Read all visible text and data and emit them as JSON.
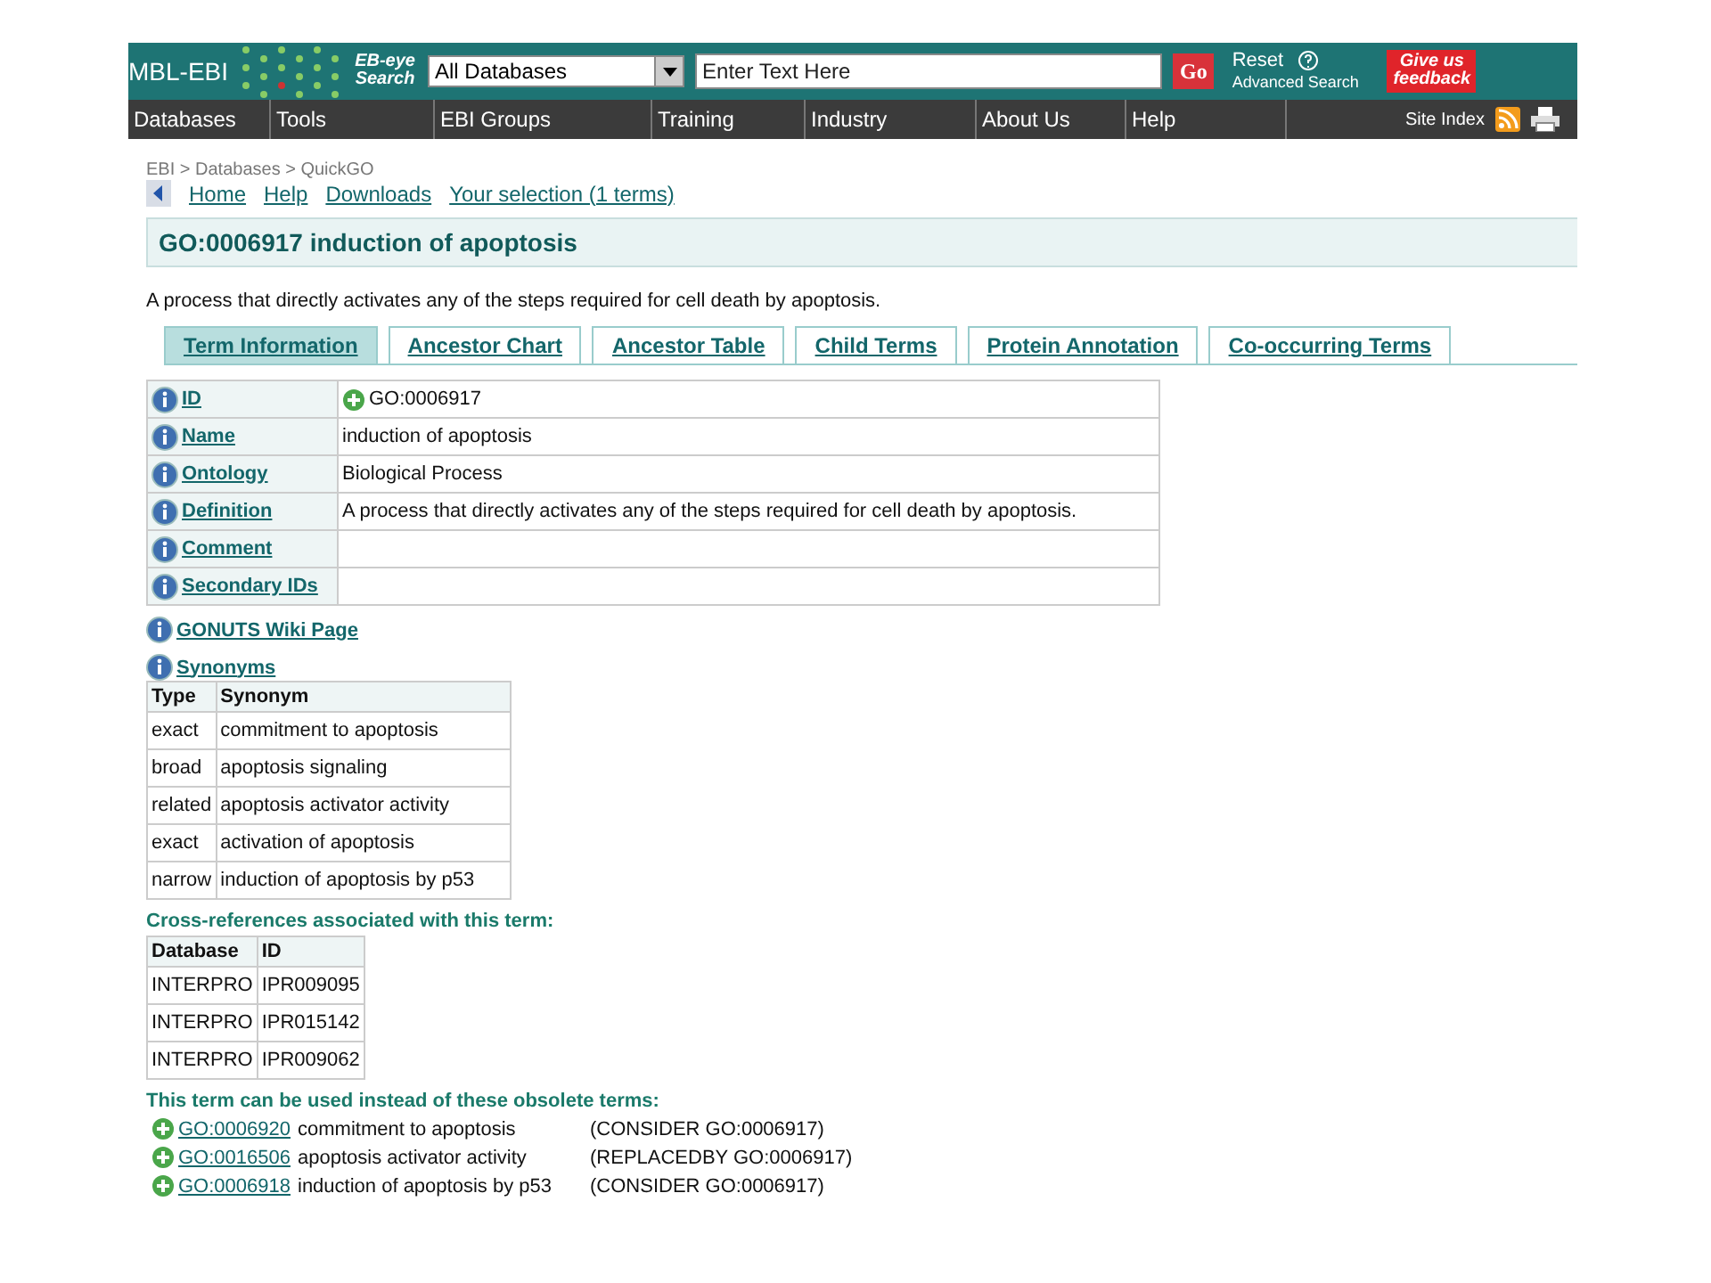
{
  "header": {
    "logo": "MBL-EBI",
    "search_label": "EB-eye Search",
    "database_select": "All Databases",
    "search": {
      "placeholder": "Enter Text Here"
    },
    "go": "Go",
    "reset": "Reset",
    "advanced": "Advanced Search",
    "feedback": "Give us feedback"
  },
  "nav": {
    "items": [
      "Databases",
      "Tools",
      "EBI Groups",
      "Training",
      "Industry",
      "About Us",
      "Help"
    ],
    "site_index": "Site Index"
  },
  "breadcrumb": "EBI > Databases > QuickGO",
  "links": [
    "Home",
    "Help",
    "Downloads",
    "Your selection (1 terms)"
  ],
  "title": "GO:0006917 induction of apoptosis",
  "description": "A process that directly activates any of the steps required for cell death by apoptosis.",
  "tabs": [
    {
      "label": "Term Information",
      "selected": true
    },
    {
      "label": "Ancestor Chart",
      "selected": false
    },
    {
      "label": "Ancestor Table",
      "selected": false
    },
    {
      "label": "Child Terms",
      "selected": false
    },
    {
      "label": "Protein Annotation",
      "selected": false
    },
    {
      "label": "Co-occurring Terms",
      "selected": false
    }
  ],
  "term_info": [
    {
      "label": "ID",
      "value": "GO:0006917",
      "kind": "go"
    },
    {
      "label": "Name",
      "value": "induction of apoptosis",
      "kind": "text"
    },
    {
      "label": "Ontology",
      "value": "Biological Process",
      "kind": "text"
    },
    {
      "label": "Definition",
      "value": "A process that directly activates any of the steps required for cell death by apoptosis.",
      "kind": "text"
    },
    {
      "label": "Comment",
      "kind": "text"
    },
    {
      "label": "Secondary IDs",
      "kind": "text"
    }
  ],
  "wiki_link": "GONUTS Wiki Page",
  "synonyms": {
    "title": "Synonyms",
    "columns": [
      "Type",
      "Synonym"
    ],
    "rows": [
      [
        "exact",
        "commitment to apoptosis"
      ],
      [
        "broad",
        "apoptosis signaling"
      ],
      [
        "related",
        "apoptosis activator activity"
      ],
      [
        "exact",
        "activation of apoptosis"
      ],
      [
        "narrow",
        "induction of apoptosis by p53"
      ]
    ]
  },
  "xrefs": {
    "title": "Cross-references associated with this term:",
    "columns": [
      "Database",
      "ID"
    ],
    "rows": [
      [
        "INTERPRO",
        "IPR009095"
      ],
      [
        "INTERPRO",
        "IPR015142"
      ],
      [
        "INTERPRO",
        "IPR009062"
      ]
    ]
  },
  "obsolete": {
    "title": "This term can be used instead of these obsolete terms:",
    "rows": [
      {
        "id": "GO:0006920",
        "name": "commitment to apoptosis",
        "note": "(CONSIDER GO:0006917)"
      },
      {
        "id": "GO:0016506",
        "name": "apoptosis activator activity",
        "note": "(REPLACEDBY GO:0006917)"
      },
      {
        "id": "GO:0006918",
        "name": "induction of apoptosis by p53",
        "note": "(CONSIDER GO:0006917)"
      }
    ]
  }
}
